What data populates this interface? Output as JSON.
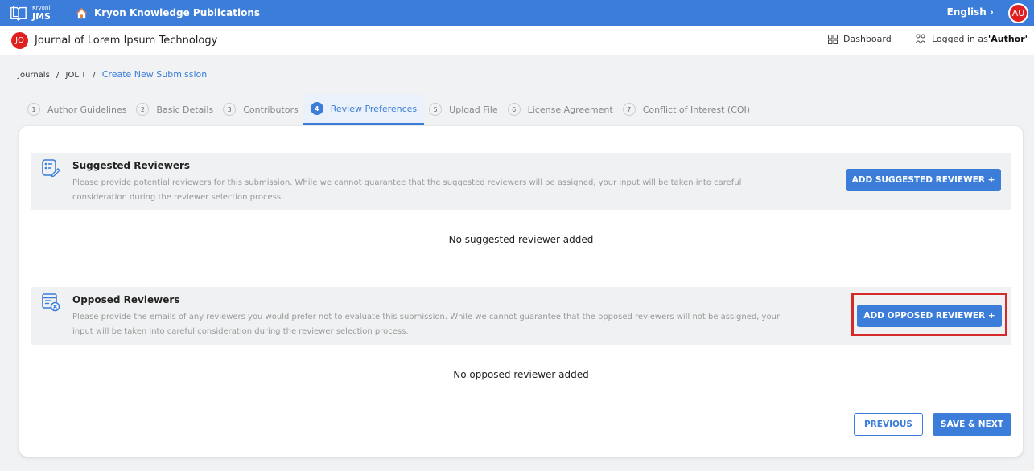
{
  "topbar": {
    "logo_small": "Kryoni",
    "logo_big": "JMS",
    "publisher": "Kryon Knowledge Publications",
    "language": "English",
    "user_initials": "AU"
  },
  "journal": {
    "initials": "JO",
    "title": "Journal of Lorem Ipsum Technology",
    "dashboard": "Dashboard",
    "logged_in_prefix": "Logged in as ",
    "role": "'Author'"
  },
  "breadcrumb": {
    "items": [
      "Journals",
      "JOLIT"
    ],
    "separator": "/",
    "current": "Create New Submission"
  },
  "steps": [
    {
      "num": "1",
      "label": "Author Guidelines"
    },
    {
      "num": "2",
      "label": "Basic Details"
    },
    {
      "num": "3",
      "label": "Contributors"
    },
    {
      "num": "4",
      "label": "Review Preferences"
    },
    {
      "num": "5",
      "label": "Upload File"
    },
    {
      "num": "6",
      "label": "License Agreement"
    },
    {
      "num": "7",
      "label": "Conflict of Interest (COI)"
    }
  ],
  "active_step": 4,
  "suggested": {
    "title": "Suggested Reviewers",
    "description": "Please provide potential reviewers for this submission. While we cannot guarantee that the suggested reviewers will be assigned, your input will be taken into careful consideration during the reviewer selection process.",
    "button": "ADD SUGGESTED REVIEWER +",
    "empty": "No suggested reviewer added"
  },
  "opposed": {
    "title": "Opposed Reviewers",
    "description": "Please provide the emails of any reviewers you would prefer not to evaluate this submission. While we cannot guarantee that the opposed reviewers will not be assigned, your input will be taken into careful consideration during the reviewer selection process.",
    "button": "ADD OPPOSED REVIEWER +",
    "empty": "No opposed reviewer added"
  },
  "footer": {
    "previous": "PREVIOUS",
    "save_next": "SAVE & NEXT"
  },
  "colors": {
    "primary": "#3b7dd8",
    "avatar": "#e02020",
    "highlight": "#d42a2a"
  }
}
